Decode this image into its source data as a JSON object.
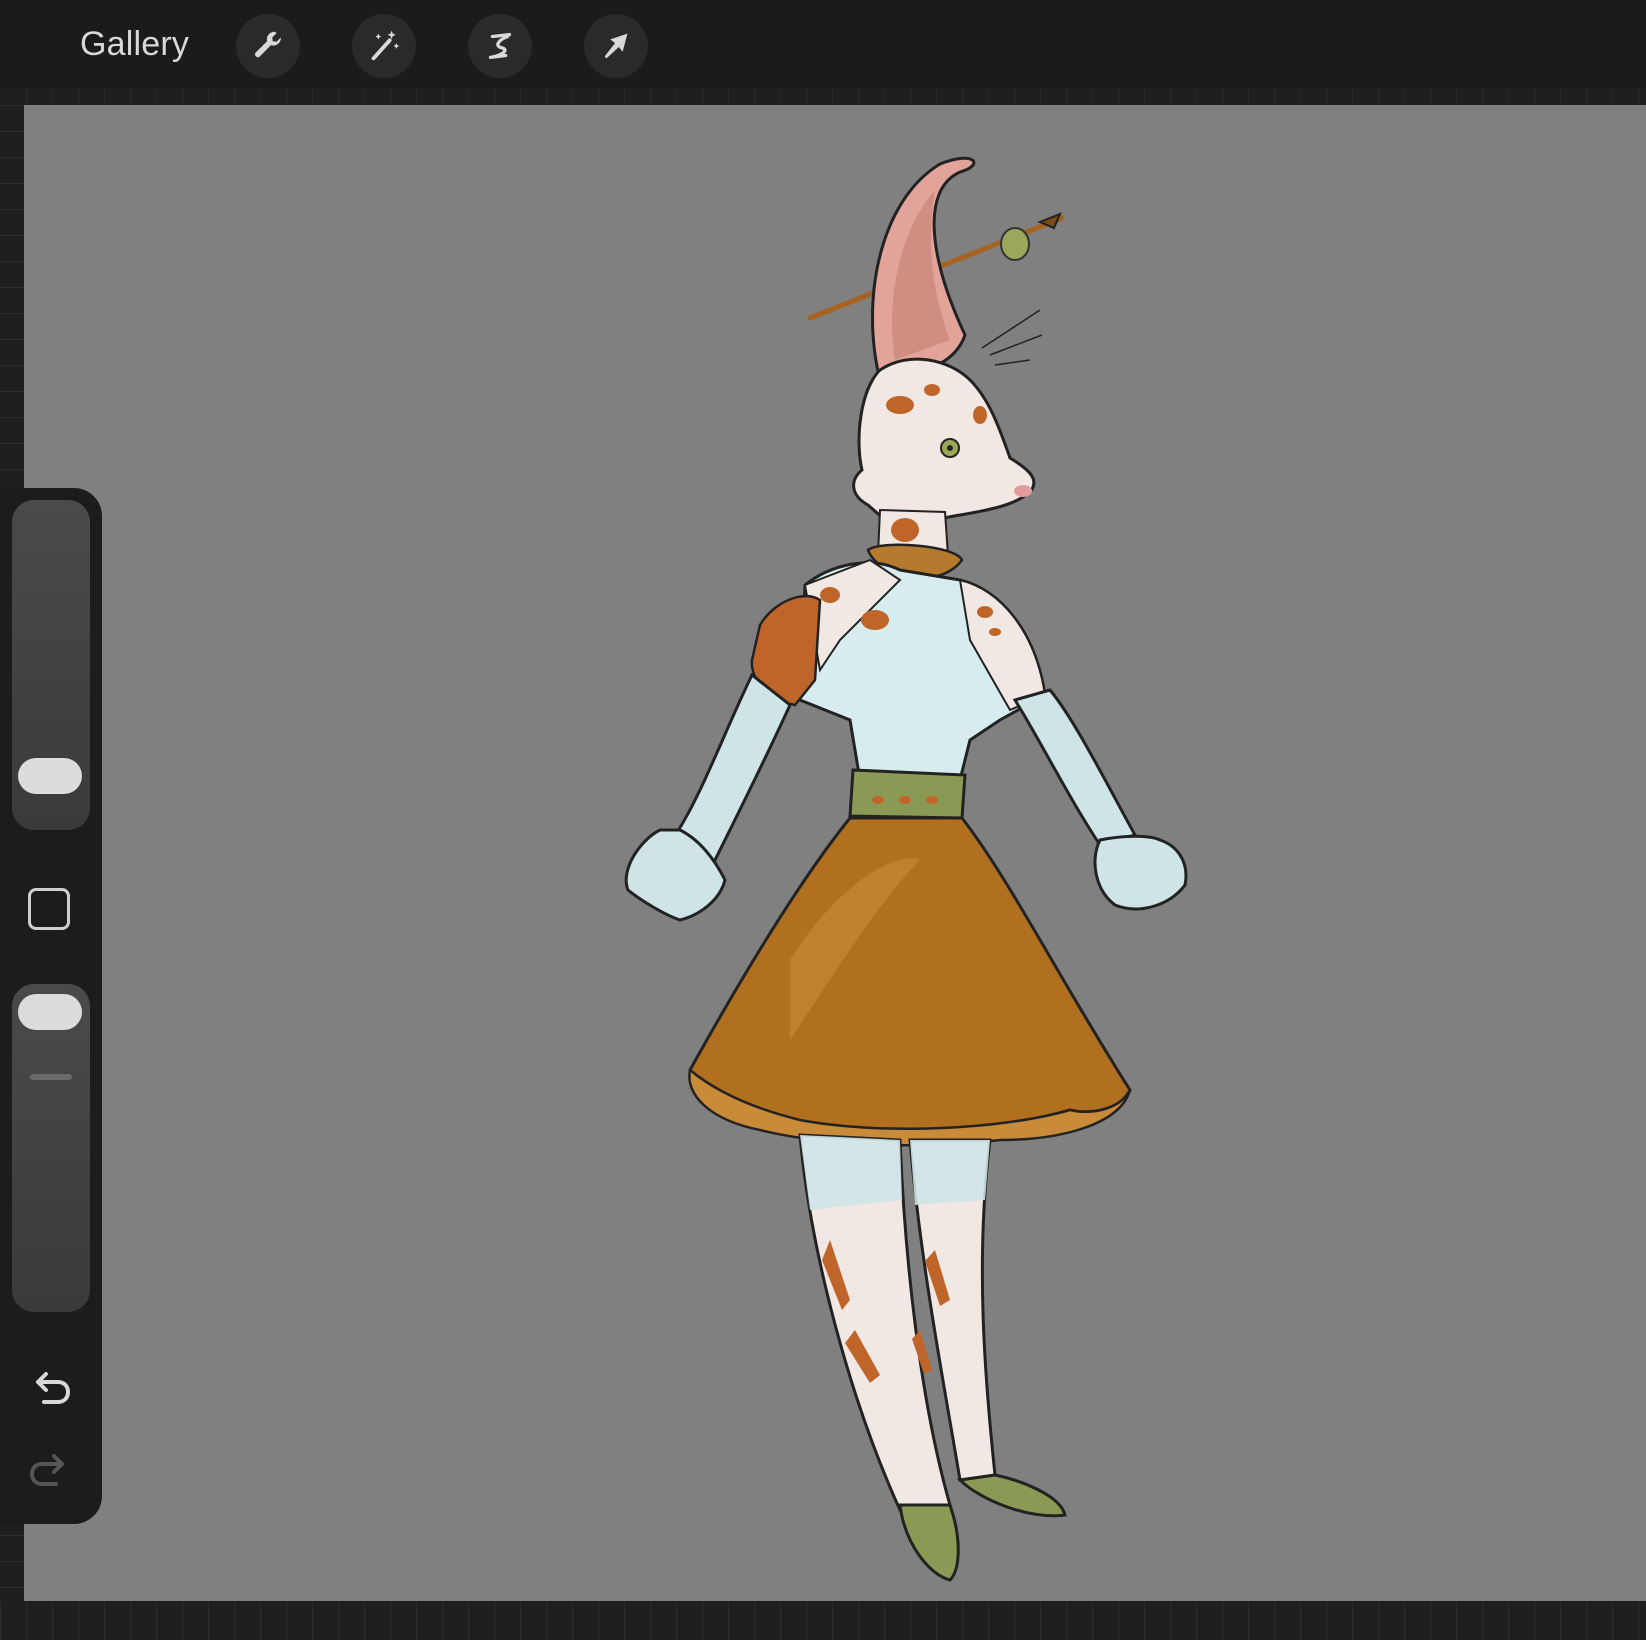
{
  "toolbar": {
    "gallery_label": "Gallery",
    "tools": [
      {
        "name": "actions",
        "icon": "wrench-icon"
      },
      {
        "name": "adjustments",
        "icon": "magic-wand-icon"
      },
      {
        "name": "selection",
        "icon": "selection-s-icon"
      },
      {
        "name": "transform",
        "icon": "arrow-cursor-icon"
      }
    ]
  },
  "sidebar": {
    "brush_size_level": 0.82,
    "opacity_level": 1.0,
    "buttons": [
      "modify-button",
      "undo-button",
      "redo-button"
    ],
    "redo_enabled": false
  },
  "canvas": {
    "background_color": "#808080",
    "artwork": "character-sketch"
  },
  "colors": {
    "toolbar_bg": "#1b1b1b",
    "icon": "#d8d8d8",
    "skirt": "#b0701f",
    "skin_blue": "#cfe4e6",
    "spots": "#c0652a",
    "ear_pink": "#e2a49a",
    "belt": "#8a9a55"
  }
}
